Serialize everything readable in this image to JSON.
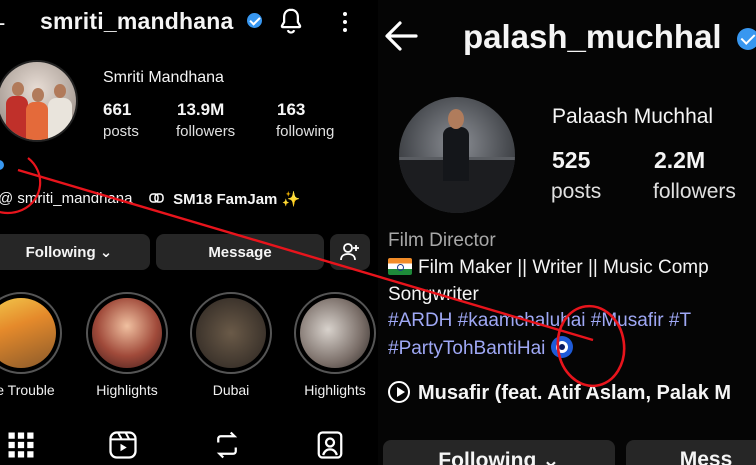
{
  "left_profile": {
    "back_glyph": "-",
    "username": "smriti_mandhana",
    "display_name": "Smriti Mandhana",
    "posts_count": "661",
    "posts_label": "posts",
    "followers_count": "13.9M",
    "followers_label": "followers",
    "following_count": "163",
    "following_label": "following",
    "threads_handle": "smriti_mandhana",
    "fam_link": "SM18 FamJam ✨",
    "following_button": "Following ⌄",
    "message_button": "Message",
    "highlights": [
      {
        "label": "ble Trouble"
      },
      {
        "label": "Highlights"
      },
      {
        "label": "Dubai"
      },
      {
        "label": "Highlights"
      }
    ]
  },
  "right_profile": {
    "username": "palash_muchhal",
    "display_name": "Palaash Muchhal",
    "posts_count": "525",
    "posts_label": "posts",
    "followers_count": "2.2M",
    "followers_label": "followers",
    "category": "Film Director",
    "bio_line1": "Film Maker || Writer || Music Comp",
    "bio_line2": "Songwriter",
    "bio_hashtags1": "#ARDH #kaamchaluhai #Musafir #T",
    "bio_hashtags2": "#PartyTohBantiHai",
    "music": "Musafir (feat. Atif Aslam, Palak M",
    "following_button": "Following ⌄",
    "message_button": "Mess"
  },
  "annotation": {
    "color": "#e8141c"
  },
  "icons": {
    "bell": "bell-icon",
    "more": "more-icon",
    "back": "back-arrow-icon",
    "threads": "threads-icon",
    "link": "link-icon",
    "add_user": "add-user-icon",
    "grid": "grid-icon",
    "reels": "reels-icon",
    "tagged": "tagged-icon",
    "repost": "repost-icon",
    "play": "play-icon",
    "flag": "india-flag-icon",
    "nazar": "evil-eye-icon"
  }
}
